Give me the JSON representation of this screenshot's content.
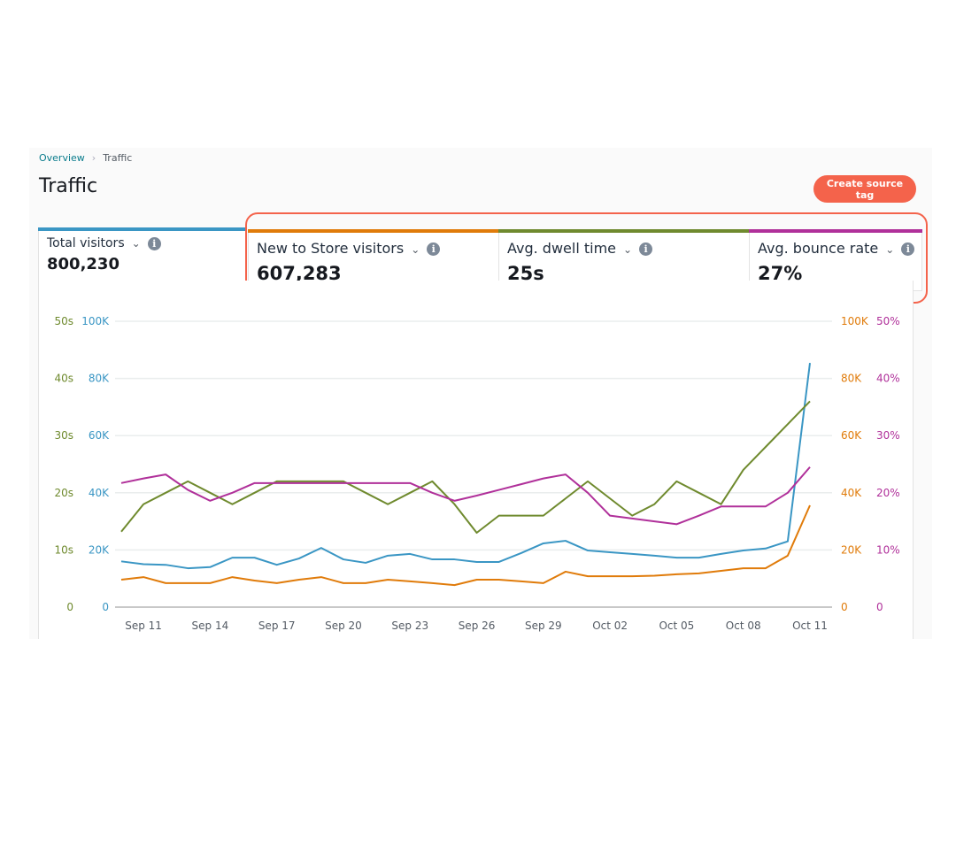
{
  "breadcrumb": {
    "items": [
      "Overview",
      "Traffic"
    ]
  },
  "page_title": "Traffic",
  "create_button": "Create source tag",
  "metrics": [
    {
      "label": "Total visitors",
      "value": "800,230",
      "color": "#3a96c4"
    },
    {
      "label": "New to Store visitors",
      "value": "607,283",
      "color": "#e07b0a"
    },
    {
      "label": "Avg. dwell time",
      "value": "25s",
      "color": "#6f8a2e"
    },
    {
      "label": "Avg. bounce rate",
      "value": "27%",
      "color": "#b0309a"
    }
  ],
  "icons": {
    "dropdown": "chevron-down-icon",
    "info": "info-icon",
    "separator": "chevron-right-icon"
  },
  "highlight_color": "#f4634b",
  "chart_data": {
    "type": "line",
    "x_tick_labels": [
      "Sep 11",
      "Sep 14",
      "Sep 17",
      "Sep 20",
      "Sep 23",
      "Sep 26",
      "Sep 29",
      "Oct 02",
      "Oct 05",
      "Oct 08",
      "Oct 11"
    ],
    "x": [
      "Sep 10",
      "Sep 11",
      "Sep 12",
      "Sep 13",
      "Sep 14",
      "Sep 15",
      "Sep 16",
      "Sep 17",
      "Sep 18",
      "Sep 19",
      "Sep 20",
      "Sep 21",
      "Sep 22",
      "Sep 23",
      "Sep 24",
      "Sep 25",
      "Sep 26",
      "Sep 27",
      "Sep 28",
      "Sep 29",
      "Sep 30",
      "Oct 01",
      "Oct 02",
      "Oct 03",
      "Oct 04",
      "Oct 05",
      "Oct 06",
      "Oct 07",
      "Oct 08",
      "Oct 09",
      "Oct 10",
      "Oct 11"
    ],
    "axes": {
      "left_seconds": {
        "ticks": [
          "0",
          "10s",
          "20s",
          "30s",
          "40s",
          "50s"
        ],
        "range": [
          0,
          50
        ],
        "color": "#6f8a2e"
      },
      "left_visitors": {
        "ticks": [
          "0",
          "20K",
          "40K",
          "60K",
          "80K",
          "100K"
        ],
        "range": [
          0,
          100000
        ],
        "color": "#3a96c4"
      },
      "right_visitors": {
        "ticks": [
          "0",
          "20K",
          "40K",
          "60K",
          "80K",
          "100K"
        ],
        "range": [
          0,
          100000
        ],
        "color": "#e07b0a"
      },
      "right_percent": {
        "ticks": [
          "0",
          "10%",
          "20%",
          "30%",
          "40%",
          "50%"
        ],
        "range": [
          0,
          50
        ],
        "color": "#b0309a"
      }
    },
    "grid": true,
    "series": [
      {
        "name": "Total visitors",
        "axis": "left_visitors",
        "color": "#3a96c4",
        "values": [
          16000,
          15000,
          14800,
          13600,
          14000,
          17300,
          17300,
          14800,
          17000,
          20700,
          16700,
          15500,
          18000,
          18600,
          16700,
          16700,
          15800,
          15800,
          18900,
          22300,
          23200,
          19800,
          19200,
          18600,
          18000,
          17300,
          17300,
          18600,
          19800,
          20500,
          23000,
          85400
        ]
      },
      {
        "name": "New to Store visitors",
        "axis": "right_visitors",
        "color": "#e07b0a",
        "values": [
          9600,
          10500,
          8400,
          8400,
          8400,
          10500,
          9300,
          8400,
          9600,
          10500,
          8400,
          8400,
          9600,
          9000,
          8400,
          7700,
          9600,
          9600,
          9000,
          8400,
          12400,
          10800,
          10800,
          10800,
          11000,
          11500,
          11800,
          12700,
          13600,
          13600,
          18000,
          35600
        ]
      },
      {
        "name": "Avg. dwell time",
        "axis": "left_seconds",
        "color": "#6f8a2e",
        "values": [
          13.2,
          18,
          20,
          22,
          20,
          18,
          20,
          22,
          22,
          22,
          22,
          20,
          18,
          20,
          22,
          18,
          13,
          16,
          16,
          16,
          19,
          22,
          19,
          16,
          18,
          22,
          20,
          18,
          24,
          28,
          32,
          36
        ]
      },
      {
        "name": "Avg. bounce rate",
        "axis": "right_percent",
        "color": "#b0309a",
        "values": [
          21.7,
          22.5,
          23.2,
          20.5,
          18.6,
          20,
          21.7,
          21.7,
          21.7,
          21.7,
          21.7,
          21.7,
          21.7,
          21.7,
          20,
          18.6,
          19.5,
          20.5,
          21.5,
          22.5,
          23.2,
          20,
          16,
          15.5,
          15,
          14.5,
          16,
          17.6,
          17.6,
          17.6,
          20,
          24.5
        ]
      }
    ]
  }
}
